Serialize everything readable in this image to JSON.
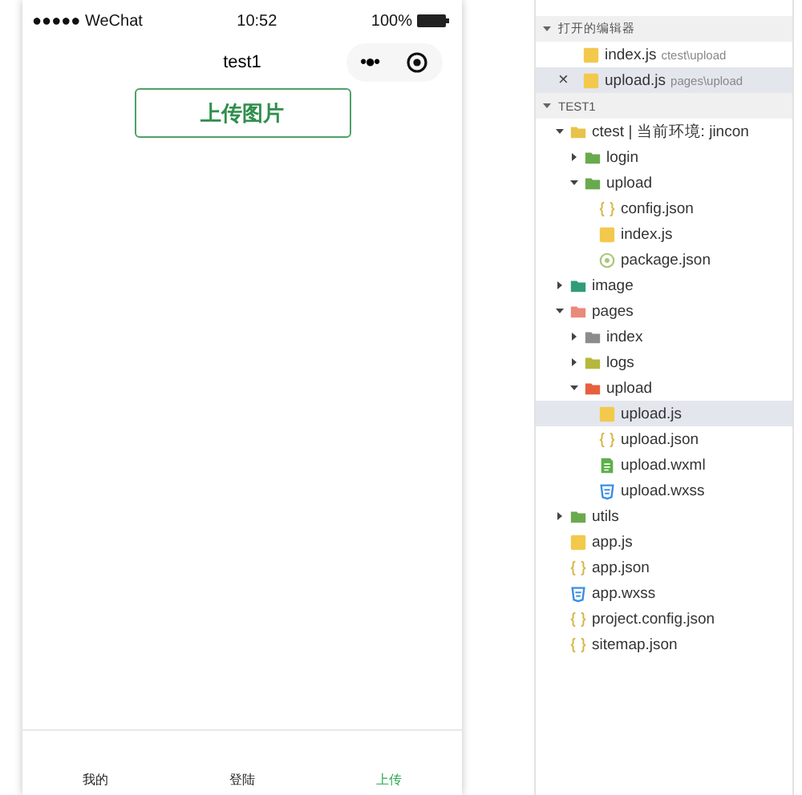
{
  "phone": {
    "status_bar": {
      "carrier": "●●●●● WeChat",
      "time": "10:52",
      "battery": "100%"
    },
    "nav": {
      "title": "test1",
      "menu": "•●•"
    },
    "upload_button": "上传图片",
    "tab_bar": [
      {
        "label": "我的",
        "selected": false
      },
      {
        "label": "登陆",
        "selected": false
      },
      {
        "label": "上传",
        "selected": true
      }
    ]
  },
  "explorer": {
    "open_editors": {
      "title": "打开的编辑器",
      "expanded": true,
      "items": [
        {
          "name": "index.js",
          "path": "ctest\\upload",
          "kind": "js",
          "selected": false
        },
        {
          "name": "upload.js",
          "path": "pages\\upload",
          "kind": "js",
          "selected": true,
          "close": "×"
        }
      ]
    },
    "project": {
      "title": "TEST1",
      "expanded": true,
      "tree": [
        {
          "name": "ctest | 当前环境: jincon",
          "kind": "folder",
          "color": "#e8c34a",
          "expanded": true,
          "selected": false,
          "children": [
            {
              "name": "login",
              "kind": "folder",
              "color": "#6aaa4e",
              "expanded": false,
              "selected": false
            },
            {
              "name": "upload",
              "kind": "folder",
              "color": "#6aaa4e",
              "expanded": true,
              "selected": false,
              "children": [
                {
                  "name": "config.json",
                  "kind": "json",
                  "selected": false
                },
                {
                  "name": "index.js",
                  "kind": "js",
                  "selected": false
                },
                {
                  "name": "package.json",
                  "kind": "package",
                  "selected": false
                }
              ]
            }
          ]
        },
        {
          "name": "image",
          "kind": "folder",
          "color": "#2f9c7a",
          "expanded": false,
          "selected": false
        },
        {
          "name": "pages",
          "kind": "folder",
          "color": "#e98a7a",
          "expanded": true,
          "selected": false,
          "children": [
            {
              "name": "index",
              "kind": "folder",
              "color": "#8c8c8c",
              "expanded": false,
              "selected": false
            },
            {
              "name": "logs",
              "kind": "folder",
              "color": "#b5b83a",
              "expanded": false,
              "selected": false
            },
            {
              "name": "upload",
              "kind": "folder",
              "color": "#e6603f",
              "expanded": true,
              "selected": false,
              "children": [
                {
                  "name": "upload.js",
                  "kind": "js",
                  "selected": true
                },
                {
                  "name": "upload.json",
                  "kind": "json",
                  "selected": false
                },
                {
                  "name": "upload.wxml",
                  "kind": "wxml",
                  "selected": false
                },
                {
                  "name": "upload.wxss",
                  "kind": "wxss",
                  "selected": false
                }
              ]
            }
          ]
        },
        {
          "name": "utils",
          "kind": "folder",
          "color": "#6aaa4e",
          "expanded": false,
          "selected": false
        },
        {
          "name": "app.js",
          "kind": "js",
          "selected": false
        },
        {
          "name": "app.json",
          "kind": "json",
          "selected": false
        },
        {
          "name": "app.wxss",
          "kind": "wxss",
          "selected": false
        },
        {
          "name": "project.config.json",
          "kind": "json",
          "selected": false
        },
        {
          "name": "sitemap.json",
          "kind": "json",
          "selected": false
        }
      ]
    }
  }
}
